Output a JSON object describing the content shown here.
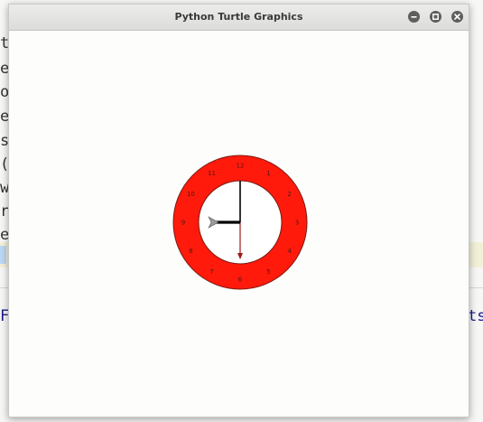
{
  "window": {
    "title": "Python Turtle Graphics",
    "controls": [
      "minimize",
      "maximize",
      "close"
    ]
  },
  "background_editor": {
    "left_edge_chars": [
      "t_",
      "e",
      "o",
      "e",
      "s",
      "(",
      "w",
      "r",
      "e"
    ],
    "bottom_left_fragment": "F",
    "bottom_right_fragment": "ts"
  },
  "clock": {
    "numbers": [
      "12",
      "1",
      "2",
      "3",
      "4",
      "5",
      "6",
      "7",
      "8",
      "9",
      "10",
      "11"
    ],
    "hour_hand_points_to": "9",
    "minute_hand_points_to": "12",
    "second_hand_points_to": "6",
    "colors": {
      "ring": "#ff1a0c",
      "face": "#ffffff",
      "outline": "#7a1a12",
      "numbers": "#4a1a10",
      "hour_hand": "#000000",
      "minute_hand": "#000000",
      "second_hand": "#a01818"
    }
  },
  "turtle_cursor": "arrow-cursor-icon"
}
